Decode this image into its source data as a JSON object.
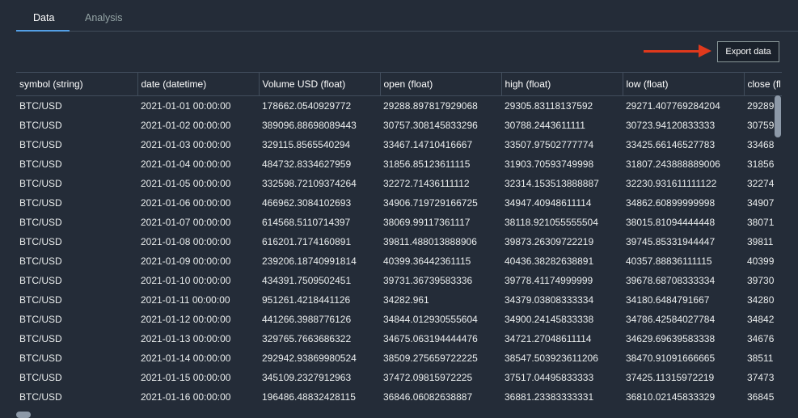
{
  "tabs": [
    {
      "label": "Data",
      "active": true
    },
    {
      "label": "Analysis",
      "active": false
    }
  ],
  "toolbar": {
    "export_label": "Export data"
  },
  "colors": {
    "accent": "#539fe5",
    "arrow": "#e0391c",
    "background": "#242c38"
  },
  "table": {
    "columns": [
      "symbol (string)",
      "date (datetime)",
      "Volume USD (float)",
      "open (float)",
      "high (float)",
      "low (float)",
      "close (fl"
    ],
    "rows": [
      [
        "BTC/USD",
        "2021-01-01 00:00:00",
        "178662.0540929772",
        "29288.897817929068",
        "29305.83118137592",
        "29271.407769284204",
        "29289"
      ],
      [
        "BTC/USD",
        "2021-01-02 00:00:00",
        "389096.88698089443",
        "30757.308145833296",
        "30788.2443611111",
        "30723.94120833333",
        "30759"
      ],
      [
        "BTC/USD",
        "2021-01-03 00:00:00",
        "329115.8565540294",
        "33467.14710416667",
        "33507.97502777774",
        "33425.66146527783",
        "33468"
      ],
      [
        "BTC/USD",
        "2021-01-04 00:00:00",
        "484732.8334627959",
        "31856.85123611115",
        "31903.70593749998",
        "31807.243888889006",
        "31856"
      ],
      [
        "BTC/USD",
        "2021-01-05 00:00:00",
        "332598.72109374264",
        "32272.71436111112",
        "32314.153513888887",
        "32230.931611111122",
        "32274"
      ],
      [
        "BTC/USD",
        "2021-01-06 00:00:00",
        "466962.3084102693",
        "34906.719729166725",
        "34947.40948611114",
        "34862.60899999998",
        "34907"
      ],
      [
        "BTC/USD",
        "2021-01-07 00:00:00",
        "614568.5110714397",
        "38069.99117361117",
        "38118.921055555504",
        "38015.81094444448",
        "38071"
      ],
      [
        "BTC/USD",
        "2021-01-08 00:00:00",
        "616201.7174160891",
        "39811.488013888906",
        "39873.26309722219",
        "39745.85331944447",
        "39811"
      ],
      [
        "BTC/USD",
        "2021-01-09 00:00:00",
        "239206.18740991814",
        "40399.36442361115",
        "40436.38282638891",
        "40357.88836111115",
        "40399"
      ],
      [
        "BTC/USD",
        "2021-01-10 00:00:00",
        "434391.7509502451",
        "39731.36739583336",
        "39778.41174999999",
        "39678.68708333334",
        "39730"
      ],
      [
        "BTC/USD",
        "2021-01-11 00:00:00",
        "951261.4218441126",
        "34282.961",
        "34379.03808333334",
        "34180.6484791667",
        "34280"
      ],
      [
        "BTC/USD",
        "2021-01-12 00:00:00",
        "441266.3988776126",
        "34844.012930555604",
        "34900.24145833338",
        "34786.42584027784",
        "34842"
      ],
      [
        "BTC/USD",
        "2021-01-13 00:00:00",
        "329765.7663686322",
        "34675.063194444476",
        "34721.27048611114",
        "34629.69639583338",
        "34676"
      ],
      [
        "BTC/USD",
        "2021-01-14 00:00:00",
        "292942.93869980524",
        "38509.275659722225",
        "38547.503923611206",
        "38470.91091666665",
        "38511"
      ],
      [
        "BTC/USD",
        "2021-01-15 00:00:00",
        "345109.2327912963",
        "37472.09815972225",
        "37517.04495833333",
        "37425.11315972219",
        "37473"
      ],
      [
        "BTC/USD",
        "2021-01-16 00:00:00",
        "196486.48832428115",
        "36846.06082638887",
        "36881.23383333331",
        "36810.02145833329",
        "36845"
      ]
    ]
  }
}
